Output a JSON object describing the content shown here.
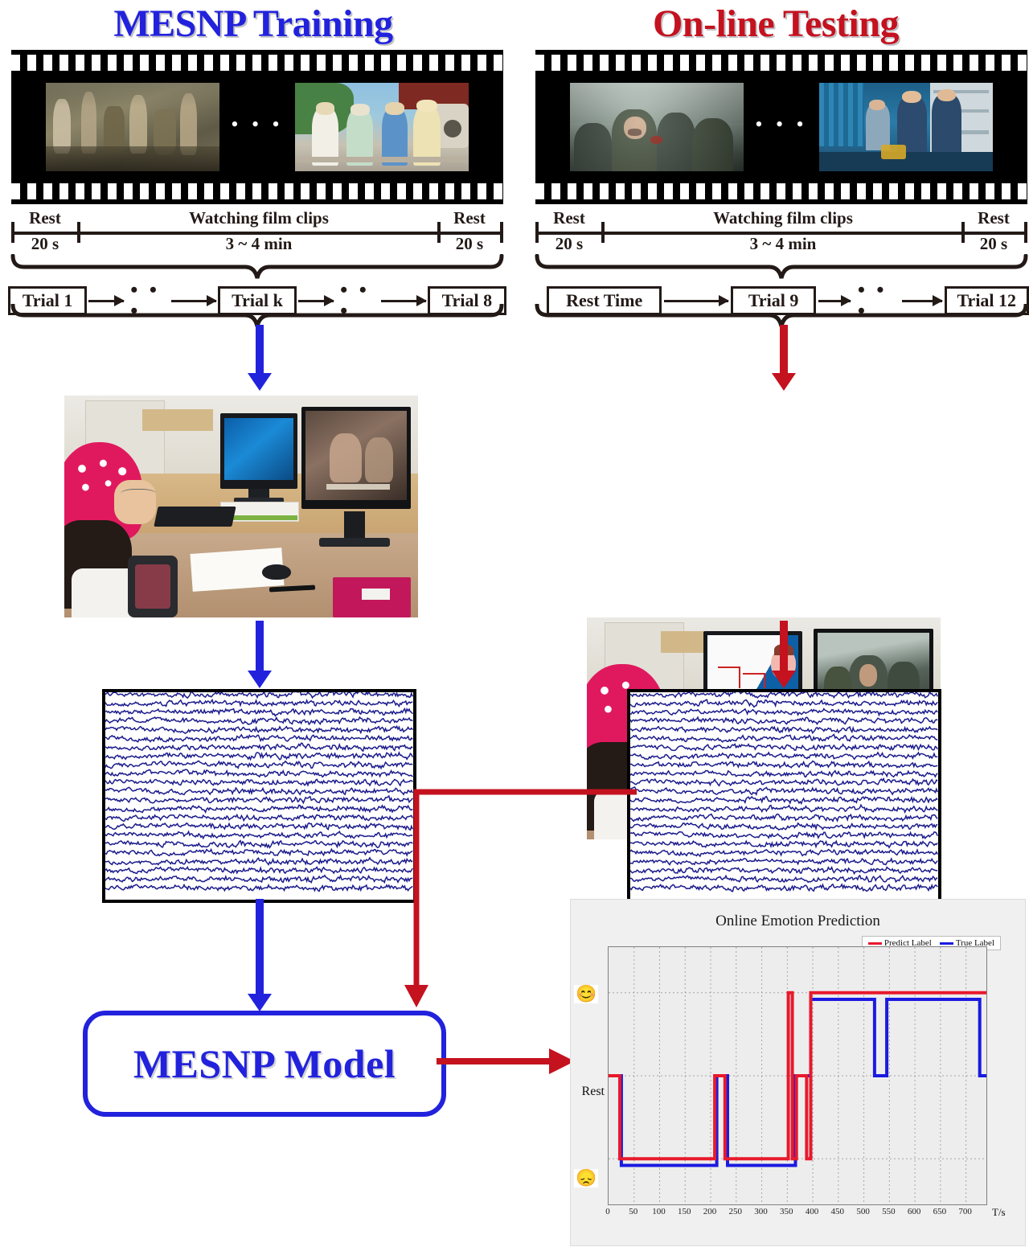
{
  "panels": {
    "left": {
      "title": "MESNP Training",
      "title_color": "#2222dd",
      "timeline": {
        "rest_left_label": "Rest",
        "rest_left_value": "20 s",
        "middle_label": "Watching film clips",
        "middle_value": "3 ~ 4 min",
        "rest_right_label": "Rest",
        "rest_right_value": "20 s"
      },
      "trials": [
        "Trial 1",
        "Trial k",
        "Trial 8"
      ],
      "trial_dots": "• • •",
      "film_dots": "• • •",
      "photo_alt": "participant wearing red EEG cap watching film clip on monitor"
    },
    "right": {
      "title": "On-line Testing",
      "title_color": "#c4121f",
      "timeline": {
        "rest_left_label": "Rest",
        "rest_left_value": "20 s",
        "middle_label": "Watching film clips",
        "middle_value": "3 ~ 4 min",
        "rest_right_label": "Rest",
        "rest_right_value": "20 s"
      },
      "trials": [
        "Rest Time",
        "Trial 9",
        "Trial 12"
      ],
      "trial_dots": "• • •",
      "film_dots": "• • •",
      "photo_alt": "participant wearing red EEG cap with online emotion prediction display"
    }
  },
  "model": {
    "label": "MESNP Model",
    "color": "#2222dd"
  },
  "chart_data": {
    "type": "line",
    "title": "Online Emotion Prediction",
    "xlabel": "T/s",
    "ylabel": "",
    "xlim": [
      0,
      740
    ],
    "xticks": [
      0,
      50,
      100,
      150,
      200,
      250,
      300,
      350,
      400,
      450,
      500,
      550,
      600,
      650,
      700
    ],
    "ylim": [
      -1.55,
      1.55
    ],
    "yticks": [
      1,
      0,
      -1
    ],
    "yticklabels": [
      "happy-emoji",
      "Rest",
      "sad-emoji"
    ],
    "ytick_rest_label": "Rest",
    "ytick_happy_icon": "happy-face-icon",
    "ytick_sad_icon": "sad-face-icon",
    "grid": true,
    "legend_position": "top-right",
    "series": [
      {
        "name": "Predict Label",
        "color": "#e8192c",
        "step": true,
        "points": [
          [
            0,
            0
          ],
          [
            22,
            0
          ],
          [
            22,
            -1
          ],
          [
            208,
            -1
          ],
          [
            208,
            0
          ],
          [
            228,
            0
          ],
          [
            228,
            -1
          ],
          [
            352,
            -1
          ],
          [
            352,
            1
          ],
          [
            360,
            1
          ],
          [
            360,
            -1
          ],
          [
            368,
            -1
          ],
          [
            368,
            0
          ],
          [
            388,
            0
          ],
          [
            388,
            -1
          ],
          [
            396,
            -1
          ],
          [
            396,
            1
          ],
          [
            740,
            1
          ]
        ]
      },
      {
        "name": "True Label",
        "color": "#1a1ae0",
        "step": true,
        "points": [
          [
            0,
            0
          ],
          [
            25,
            0
          ],
          [
            25,
            -1.08
          ],
          [
            212,
            -1.08
          ],
          [
            212,
            0
          ],
          [
            233,
            0
          ],
          [
            233,
            -1.08
          ],
          [
            366,
            -1.08
          ],
          [
            366,
            0
          ],
          [
            396,
            0
          ],
          [
            396,
            0.92
          ],
          [
            521,
            0.92
          ],
          [
            521,
            0
          ],
          [
            545,
            0
          ],
          [
            545,
            0.92
          ],
          [
            727,
            0.92
          ],
          [
            727,
            0
          ],
          [
            740,
            0
          ]
        ]
      }
    ]
  }
}
